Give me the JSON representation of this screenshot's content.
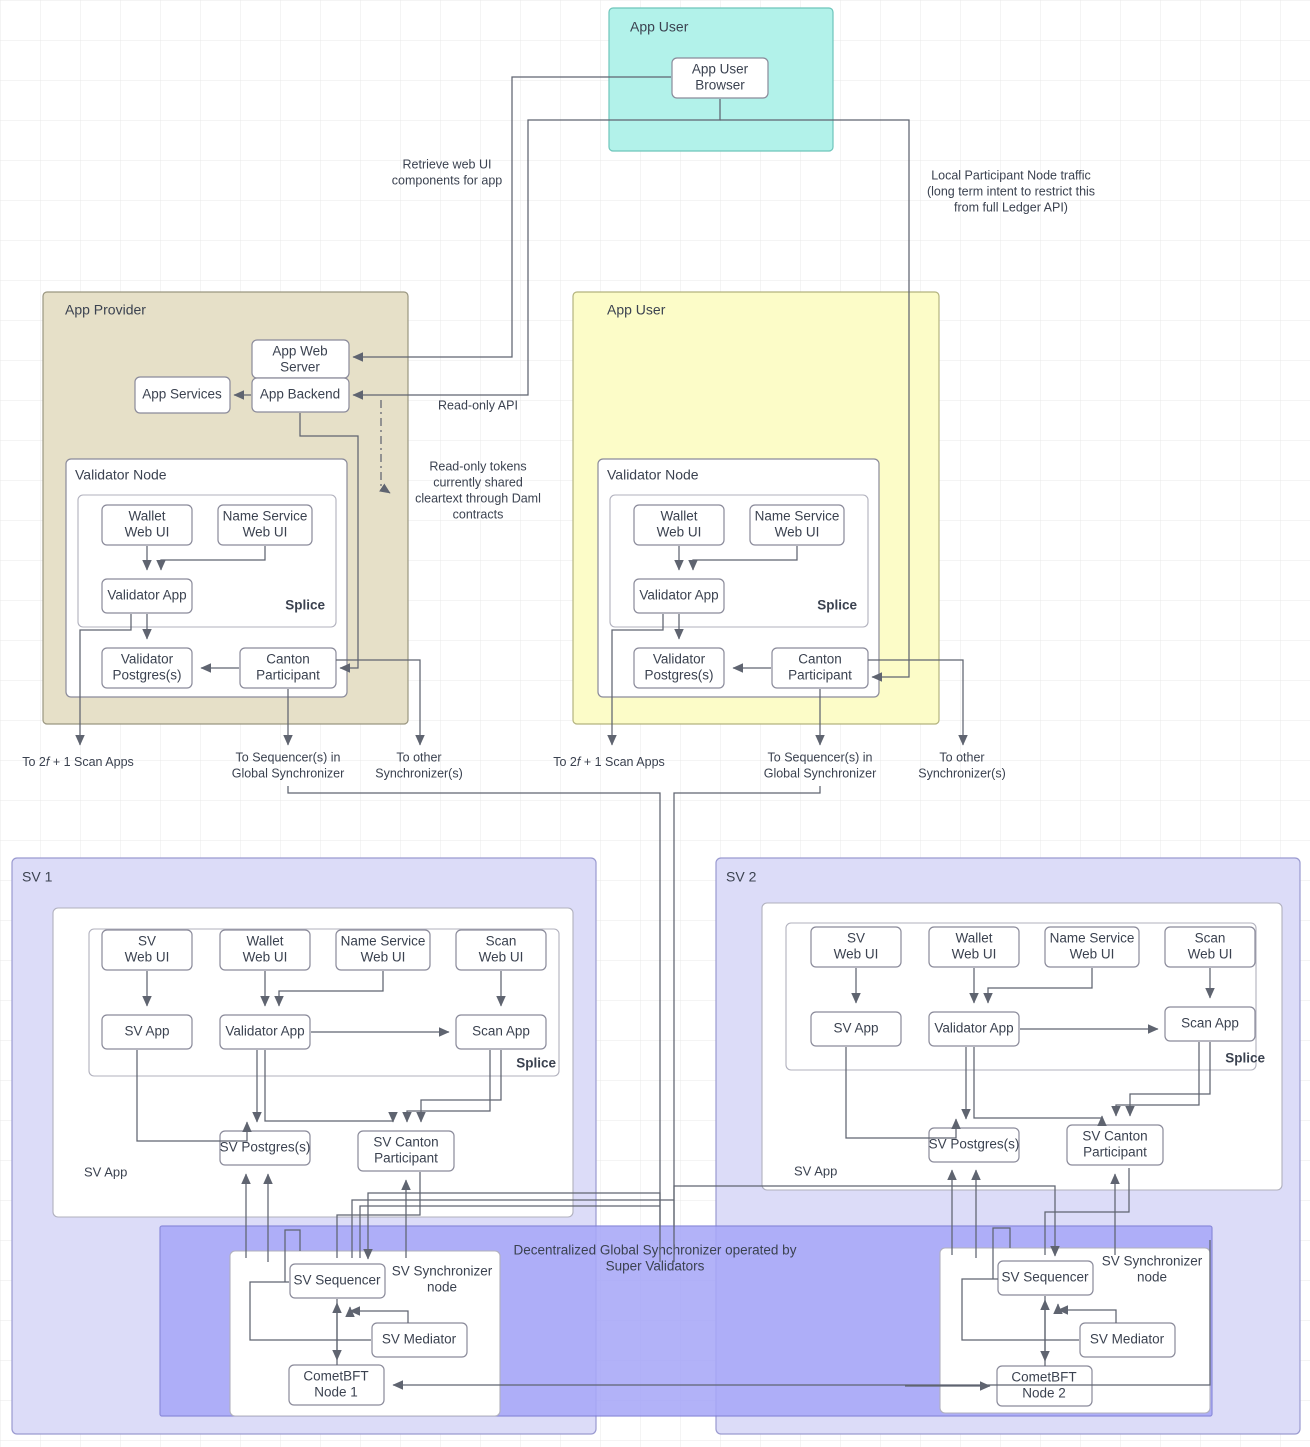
{
  "diagram": {
    "title": "Splice / Canton Network node architecture",
    "colors": {
      "teal": "#b2f2ea",
      "tan": "#e6e0c8",
      "yellow": "#fcfcc8",
      "sv_zone": "#dcdcf8",
      "synchronizer": "#a8a8f8",
      "node_fill": "#ffffff",
      "stroke": "#5f6470"
    },
    "zones": {
      "app_user_top": "App User",
      "app_provider": "App Provider",
      "app_user_main": "App User",
      "sv1": "SV 1",
      "sv2": "SV 2",
      "global_synchronizer": "Decentralized Global Synchronizer operated by Super Validators"
    },
    "nodes": {
      "app_user_browser": "App User Browser",
      "app_web_server": "App Web Server",
      "app_backend": "App Backend",
      "app_services": "App Services",
      "validator_node": "Validator Node",
      "wallet_web_ui": "Wallet Web UI",
      "name_service_web_ui": "Name Service Web UI",
      "validator_app": "Validator App",
      "validator_postgres": "Validator Postgres(s)",
      "canton_participant": "Canton Participant",
      "splice": "Splice",
      "sv_web_ui": "SV Web UI",
      "scan_web_ui": "Scan Web UI",
      "sv_app_box": "SV App",
      "scan_app": "Scan App",
      "sv_postgres": "SV Postgres(s)",
      "sv_canton_participant": "SV Canton Participant",
      "sv_app_label": "SV App",
      "sv_synchronizer_node": "SV Synchronizer node",
      "sv_sequencer": "SV Sequencer",
      "sv_mediator": "SV Mediator",
      "cometbft_node_1": "CometBFT Node 1",
      "cometbft_node_2": "CometBFT Node 2"
    },
    "annotations": {
      "retrieve_web_ui": "Retrieve web UI components for app",
      "local_participant": "Local Participant Node traffic (long term intent to restrict this from full Ledger API)",
      "read_only_api": "Read-only API",
      "read_only_tokens": "Read-only tokens currently shared cleartext through Daml contracts",
      "to_scan_apps_prefix": "To 2",
      "to_scan_apps_italic": "f",
      "to_scan_apps_suffix": " + 1 Scan Apps",
      "to_sequencers": "To Sequencer(s) in Global Synchronizer",
      "to_other_sync": "To other Synchronizer(s)"
    },
    "annotation_lines": {
      "retrieve_web_ui": [
        "Retrieve web UI",
        "components for app"
      ],
      "local_participant": [
        "Local Participant Node traffic",
        "(long term intent to restrict this",
        "from full Ledger API)"
      ],
      "read_only_tokens": [
        "Read-only tokens",
        "currently shared",
        "cleartext through Daml",
        "contracts"
      ],
      "to_sequencers": [
        "To Sequencer(s) in",
        "Global Synchronizer"
      ],
      "to_other_sync": [
        "To other",
        "Synchronizer(s)"
      ],
      "global_synchronizer": [
        "Decentralized Global Synchronizer operated by",
        "Super Validators"
      ],
      "sv_synchronizer_node": [
        "SV Synchronizer",
        "node"
      ]
    }
  }
}
